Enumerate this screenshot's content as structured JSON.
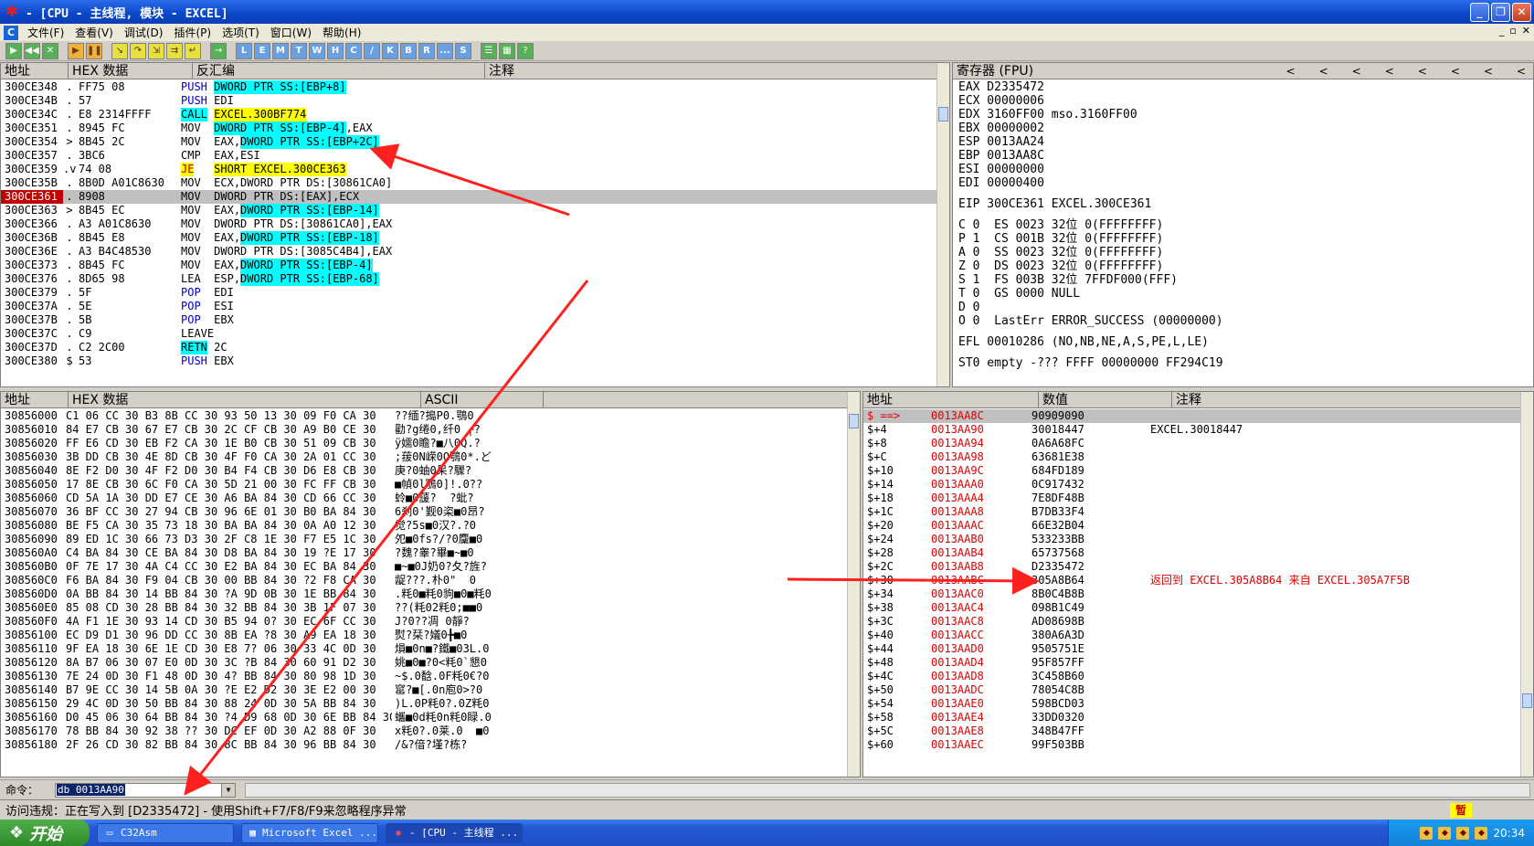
{
  "window": {
    "title": "- [CPU - 主线程, 模块 - EXCEL]",
    "logo_icon": "olly-bug-icon"
  },
  "menu": [
    "文件(F)",
    "查看(V)",
    "调试(D)",
    "插件(P)",
    "选项(T)",
    "窗口(W)",
    "帮助(H)"
  ],
  "toolbar_letters": [
    "L",
    "E",
    "M",
    "T",
    "W",
    "H",
    "C",
    "/",
    "K",
    "B",
    "R",
    "...",
    "S"
  ],
  "cpu": {
    "headers": [
      "地址",
      "HEX 数据",
      "反汇编",
      "注释"
    ],
    "rows": [
      {
        "addr": "300CE348",
        "arrow": ".",
        "hex": "FF75 08",
        "mn": "PUSH",
        "ops": [
          {
            "t": "DWORD PTR SS:[EBP+8]",
            "c": "mem"
          }
        ],
        "cmt": ""
      },
      {
        "addr": "300CE34B",
        "arrow": ".",
        "hex": "57",
        "mn": "PUSH",
        "ops": [
          {
            "t": "EDI",
            "c": ""
          }
        ],
        "cmt": ""
      },
      {
        "addr": "300CE34C",
        "arrow": ".",
        "hex": "E8 2314FFFF",
        "mn": "CALL",
        "ops": [
          {
            "t": "EXCEL.300BF774",
            "c": "y"
          }
        ],
        "cmt": ""
      },
      {
        "addr": "300CE351",
        "arrow": ".",
        "hex": "8945 FC",
        "mn": "MOV",
        "ops": [
          {
            "t": "DWORD PTR SS:[EBP-4]",
            "c": "mem"
          },
          {
            "t": ",EAX",
            "c": ""
          }
        ],
        "cmt": ""
      },
      {
        "addr": "300CE354",
        "arrow": ">",
        "hex": "8B45 2C",
        "mn": "MOV",
        "ops": [
          {
            "t": "EAX,",
            "c": ""
          },
          {
            "t": "DWORD PTR SS:[EBP+2C]",
            "c": "mem"
          }
        ],
        "cmt": ""
      },
      {
        "addr": "300CE357",
        "arrow": ".",
        "hex": "3BC6",
        "mn": "CMP",
        "ops": [
          {
            "t": "EAX,ESI",
            "c": ""
          }
        ],
        "cmt": ""
      },
      {
        "addr": "300CE359",
        "arrow": ".v",
        "hex": "74 08",
        "mn": "JE",
        "ops": [
          {
            "t": "SHORT EXCEL.300CE363",
            "c": "y"
          }
        ],
        "cmt": ""
      },
      {
        "addr": "300CE35B",
        "arrow": ".",
        "hex": "8B0D A01C8630",
        "mn": "MOV",
        "ops": [
          {
            "t": "ECX,DWORD PTR DS:[30861CA0]",
            "c": ""
          }
        ],
        "cmt": ""
      },
      {
        "addr": "300CE361",
        "arrow": ".",
        "hex": "8908",
        "mn": "MOV",
        "ops": [
          {
            "t": "DWORD PTR DS:[EAX],ECX",
            "c": ""
          }
        ],
        "cmt": "",
        "hl": true,
        "cur": true
      },
      {
        "addr": "300CE363",
        "arrow": ">",
        "hex": "8B45 EC",
        "mn": "MOV",
        "ops": [
          {
            "t": "EAX,",
            "c": ""
          },
          {
            "t": "DWORD PTR SS:[EBP-14]",
            "c": "mem"
          }
        ],
        "cmt": ""
      },
      {
        "addr": "300CE366",
        "arrow": ".",
        "hex": "A3 A01C8630",
        "mn": "MOV",
        "ops": [
          {
            "t": "DWORD PTR DS:[30861CA0],EAX",
            "c": ""
          }
        ],
        "cmt": ""
      },
      {
        "addr": "300CE36B",
        "arrow": ".",
        "hex": "8B45 E8",
        "mn": "MOV",
        "ops": [
          {
            "t": "EAX,",
            "c": ""
          },
          {
            "t": "DWORD PTR SS:[EBP-18]",
            "c": "mem"
          }
        ],
        "cmt": ""
      },
      {
        "addr": "300CE36E",
        "arrow": ".",
        "hex": "A3 B4C48530",
        "mn": "MOV",
        "ops": [
          {
            "t": "DWORD PTR DS:[3085C4B4],EAX",
            "c": ""
          }
        ],
        "cmt": ""
      },
      {
        "addr": "300CE373",
        "arrow": ".",
        "hex": "8B45 FC",
        "mn": "MOV",
        "ops": [
          {
            "t": "EAX,",
            "c": ""
          },
          {
            "t": "DWORD PTR SS:[EBP-4]",
            "c": "mem"
          }
        ],
        "cmt": ""
      },
      {
        "addr": "300CE376",
        "arrow": ".",
        "hex": "8D65 98",
        "mn": "LEA",
        "ops": [
          {
            "t": "ESP,",
            "c": ""
          },
          {
            "t": "DWORD PTR SS:[EBP-68]",
            "c": "mem"
          }
        ],
        "cmt": ""
      },
      {
        "addr": "300CE379",
        "arrow": ".",
        "hex": "5F",
        "mn": "POP",
        "ops": [
          {
            "t": "EDI",
            "c": ""
          }
        ],
        "cmt": ""
      },
      {
        "addr": "300CE37A",
        "arrow": ".",
        "hex": "5E",
        "mn": "POP",
        "ops": [
          {
            "t": "ESI",
            "c": ""
          }
        ],
        "cmt": ""
      },
      {
        "addr": "300CE37B",
        "arrow": ".",
        "hex": "5B",
        "mn": "POP",
        "ops": [
          {
            "t": "EBX",
            "c": ""
          }
        ],
        "cmt": ""
      },
      {
        "addr": "300CE37C",
        "arrow": ".",
        "hex": "C9",
        "mn": "LEAVE",
        "ops": [],
        "cmt": ""
      },
      {
        "addr": "300CE37D",
        "arrow": ".",
        "hex": "C2 2C00",
        "mn": "RETN",
        "ops": [
          {
            "t": "2C",
            "c": ""
          }
        ],
        "cmt": ""
      },
      {
        "addr": "300CE380",
        "arrow": "$",
        "hex": "53",
        "mn": "PUSH",
        "ops": [
          {
            "t": "EBX",
            "c": ""
          }
        ],
        "cmt": ""
      }
    ]
  },
  "registers": {
    "title": "寄存器 (FPU)",
    "nav_arrows": [
      "<",
      "<",
      "<",
      "<",
      "<",
      "<",
      "<",
      "<"
    ],
    "lines": [
      "EAX D2335472",
      "ECX 00000006",
      "EDX 3160FF00 mso.3160FF00",
      "EBX 00000002",
      "ESP 0013AA24",
      "EBP 0013AA8C",
      "ESI 00000000",
      "EDI 00000400",
      "",
      "EIP 300CE361 EXCEL.300CE361",
      "",
      "C 0  ES 0023 32位 0(FFFFFFFF)",
      "P 1  CS 001B 32位 0(FFFFFFFF)",
      "A 0  SS 0023 32位 0(FFFFFFFF)",
      "Z 0  DS 0023 32位 0(FFFFFFFF)",
      "S 1  FS 003B 32位 7FFDF000(FFF)",
      "T 0  GS 0000 NULL",
      "D 0",
      "O 0  LastErr ERROR_SUCCESS (00000000)",
      "",
      "EFL 00010286 (NO,NB,NE,A,S,PE,L,LE)",
      "",
      "ST0 empty -??? FFFF 00000000 FF294C19"
    ]
  },
  "dump": {
    "headers": [
      "地址",
      "HEX 数据",
      "ASCII"
    ],
    "rows": [
      [
        "30856000",
        "C1 06 CC 30 B3 8B CC 30 93 50 13 30 09 F0 CA 30",
        "??缅?搗P0.鶚0"
      ],
      [
        "30856010",
        "84 E7 CB 30 67 E7 CB 30 2C CF CB 30 A9 B0 CE 30",
        "勸?g绻0,纤0 ┌?"
      ],
      [
        "30856020",
        "FF E6 CD 30 EB F2 CA 30 1E B0 CB 30 51 09 CB 30",
        "ÿ嬬0瞻?■八0Q.?"
      ],
      [
        "30856030",
        "3B DD CB 30 4E 8D CB 30 4F F0 CA 30 2A 01 CC 30",
        ";菝0N嵘0O鶚0*.ど"
      ],
      [
        "30856040",
        "8E F2 D0 30 4F F2 D0 30 B4 F4 CB 30 D6 E8 CB 30",
        "庚?0蚰0呆?驟?"
      ],
      [
        "30856050",
        "17 8E CB 30 6C F0 CA 30 5D 21 00 30 FC FF CB 30",
        "■幀0l鶚0]!.0??"
      ],
      [
        "30856060",
        "CD 5A 1A 30 DD E7 CE 30 A6 BA 84 30 CD 66 CC 30",
        "蛉■0蘐?  ?蚍?"
      ],
      [
        "30856070",
        "36 BF CC 30 27 94 CB 30 96 6E 01 30 B0 BA 84 30",
        "6刹0'觐0栥■0昂?"
      ],
      [
        "30856080",
        "BE F5 CA 30 35 73 18 30 BA BA 84 30 0A A0 12 30",
        "觉?5s■0汉?.?0"
      ],
      [
        "30856090",
        "89 ED 1C 30 66 73 D3 30 2F C8 1E 30 F7 E5 1C 30",
        "夗■0fs?/?0麜■0"
      ],
      [
        "308560A0",
        "C4 BA 84 30 CE BA 84 30 D8 BA 84 30 19 ?E 17 30",
        "?魏?睾?畢■~■0"
      ],
      [
        "308560B0",
        "0F 7E 17 30 4A C4 CC 30 E2 BA 84 30 EC BA 84 30",
        "■~■0J奶0?夂?旌?"
      ],
      [
        "308560C0",
        "F6 BA 84 30 F9 04 CB 30 00 BB 84 30 ?2 F8 CA 30",
        "龊???.朴0\"  0"
      ],
      [
        "308560D0",
        "0A BB 84 30 14 BB 84 30 ?A 9D 0B 30 1E BB 84 30",
        ".粍0■粍0豿■0■粍0"
      ],
      [
        "308560E0",
        "85 08 CD 30 28 BB 84 30 32 BB 84 30 3B 1F 07 30",
        "??(粍02粍0;■■0"
      ],
      [
        "308560F0",
        "4A F1 1E 30 93 14 CD 30 B5 94 0? 30 EC 6F CC 30",
        "J?0??凋 0靜?"
      ],
      [
        "30856100",
        "EC D9 D1 30 96 DD CC 30 8B EA ?8 30 A9 EA 18 30",
        "熨?栞?嬟0╊■0"
      ],
      [
        "30856110",
        "9F EA 18 30 6E 1E CD 30 E8 7? 06 30 33 4C 0D 30",
        "熉■0n■?鐵■03L.0"
      ],
      [
        "30856120",
        "8A B7 06 30 07 E0 0D 30 3C ?B 84 30 60 91 D2 30",
        "姚■0■?0<粍0`懇0"
      ],
      [
        "30856130",
        "7E 24 0D 30 F1 48 0D 30 4? BB 84 30 80 98 1D 30",
        "~$.0馠.0F粍0€?0"
      ],
      [
        "30856140",
        "B7 9E CC 30 14 5B 0A 30 ?E E2 D2 30 3E E2 00 30",
        "窰?■[.0n庖0>?0"
      ],
      [
        "30856150",
        "29 4C 0D 30 50 BB 84 30 88 24 0D 30 5A BB 84 30",
        ")L.0P粍0?.0Z粍0"
      ],
      [
        "30856160",
        "D0 45 06 30 64 BB 84 30 ?4 D9 68 0D 30 6E BB 84 30",
        "蠵■0d粍0n粍0睩.0"
      ],
      [
        "30856170",
        "78 BB 84 30 92 38 ?? 30 DC EF 0D 30 A2 88 0F 30",
        "x粍0?.0莱.0  ■0"
      ],
      [
        "30856180",
        "2F 26 CD 30 82 BB 84 30 8C BB 84 30 96 BB 84 30",
        "/&?偣?墐?栋?"
      ]
    ]
  },
  "stack": {
    "headers": [
      "地址",
      "数值",
      "注释"
    ],
    "rows": [
      {
        "off": "$ ==>",
        "addr": "0013AA8C",
        "val": "90909090",
        "cmt": "",
        "hl": true
      },
      {
        "off": "$+4",
        "addr": "0013AA90",
        "val": "30018447",
        "cmt": "EXCEL.30018447"
      },
      {
        "off": "$+8",
        "addr": "0013AA94",
        "val": "0A6A68FC",
        "cmt": ""
      },
      {
        "off": "$+C",
        "addr": "0013AA98",
        "val": "63681E38",
        "cmt": ""
      },
      {
        "off": "$+10",
        "addr": "0013AA9C",
        "val": "684FD189",
        "cmt": ""
      },
      {
        "off": "$+14",
        "addr": "0013AAA0",
        "val": "0C917432",
        "cmt": ""
      },
      {
        "off": "$+18",
        "addr": "0013AAA4",
        "val": "7E8DF48B",
        "cmt": ""
      },
      {
        "off": "$+1C",
        "addr": "0013AAA8",
        "val": "B7DB33F4",
        "cmt": ""
      },
      {
        "off": "$+20",
        "addr": "0013AAAC",
        "val": "66E32B04",
        "cmt": ""
      },
      {
        "off": "$+24",
        "addr": "0013AAB0",
        "val": "533233BB",
        "cmt": ""
      },
      {
        "off": "$+28",
        "addr": "0013AAB4",
        "val": "65737568",
        "cmt": ""
      },
      {
        "off": "$+2C",
        "addr": "0013AAB8",
        "val": "D2335472",
        "cmt": ""
      },
      {
        "off": "$+30",
        "addr": "0013AABC",
        "val": "305A8B64",
        "cmt": "返回到 EXCEL.305A8B64 来自 EXCEL.305A7F5B",
        "red": true
      },
      {
        "off": "$+34",
        "addr": "0013AAC0",
        "val": "8B0C4B8B",
        "cmt": ""
      },
      {
        "off": "$+38",
        "addr": "0013AAC4",
        "val": "098B1C49",
        "cmt": ""
      },
      {
        "off": "$+3C",
        "addr": "0013AAC8",
        "val": "AD08698B",
        "cmt": ""
      },
      {
        "off": "$+40",
        "addr": "0013AACC",
        "val": "380A6A3D",
        "cmt": ""
      },
      {
        "off": "$+44",
        "addr": "0013AAD0",
        "val": "9505751E",
        "cmt": ""
      },
      {
        "off": "$+48",
        "addr": "0013AAD4",
        "val": "95F857FF",
        "cmt": ""
      },
      {
        "off": "$+4C",
        "addr": "0013AAD8",
        "val": "3C458B60",
        "cmt": ""
      },
      {
        "off": "$+50",
        "addr": "0013AADC",
        "val": "78054C8B",
        "cmt": ""
      },
      {
        "off": "$+54",
        "addr": "0013AAE0",
        "val": "598BCD03",
        "cmt": ""
      },
      {
        "off": "$+58",
        "addr": "0013AAE4",
        "val": "33DD0320",
        "cmt": ""
      },
      {
        "off": "$+5C",
        "addr": "0013AAE8",
        "val": "348B47FF",
        "cmt": ""
      },
      {
        "off": "$+60",
        "addr": "0013AAEC",
        "val": "99F503BB",
        "cmt": ""
      }
    ]
  },
  "command": {
    "label": "命令：",
    "value": "db 0013AA90"
  },
  "status": {
    "text": "访问违规：正在写入到 [D2335472] - 使用Shift+F7/F8/F9来忽略程序异常",
    "pause": "暂"
  },
  "taskbar": {
    "start": "开始",
    "tasks": [
      {
        "label": "C32Asm",
        "icon": "folder-icon"
      },
      {
        "label": "Microsoft Excel ...",
        "icon": "excel-icon"
      },
      {
        "label": "- [CPU - 主线程 ...",
        "icon": "olly-bug-icon"
      }
    ],
    "clock": "20:34"
  }
}
